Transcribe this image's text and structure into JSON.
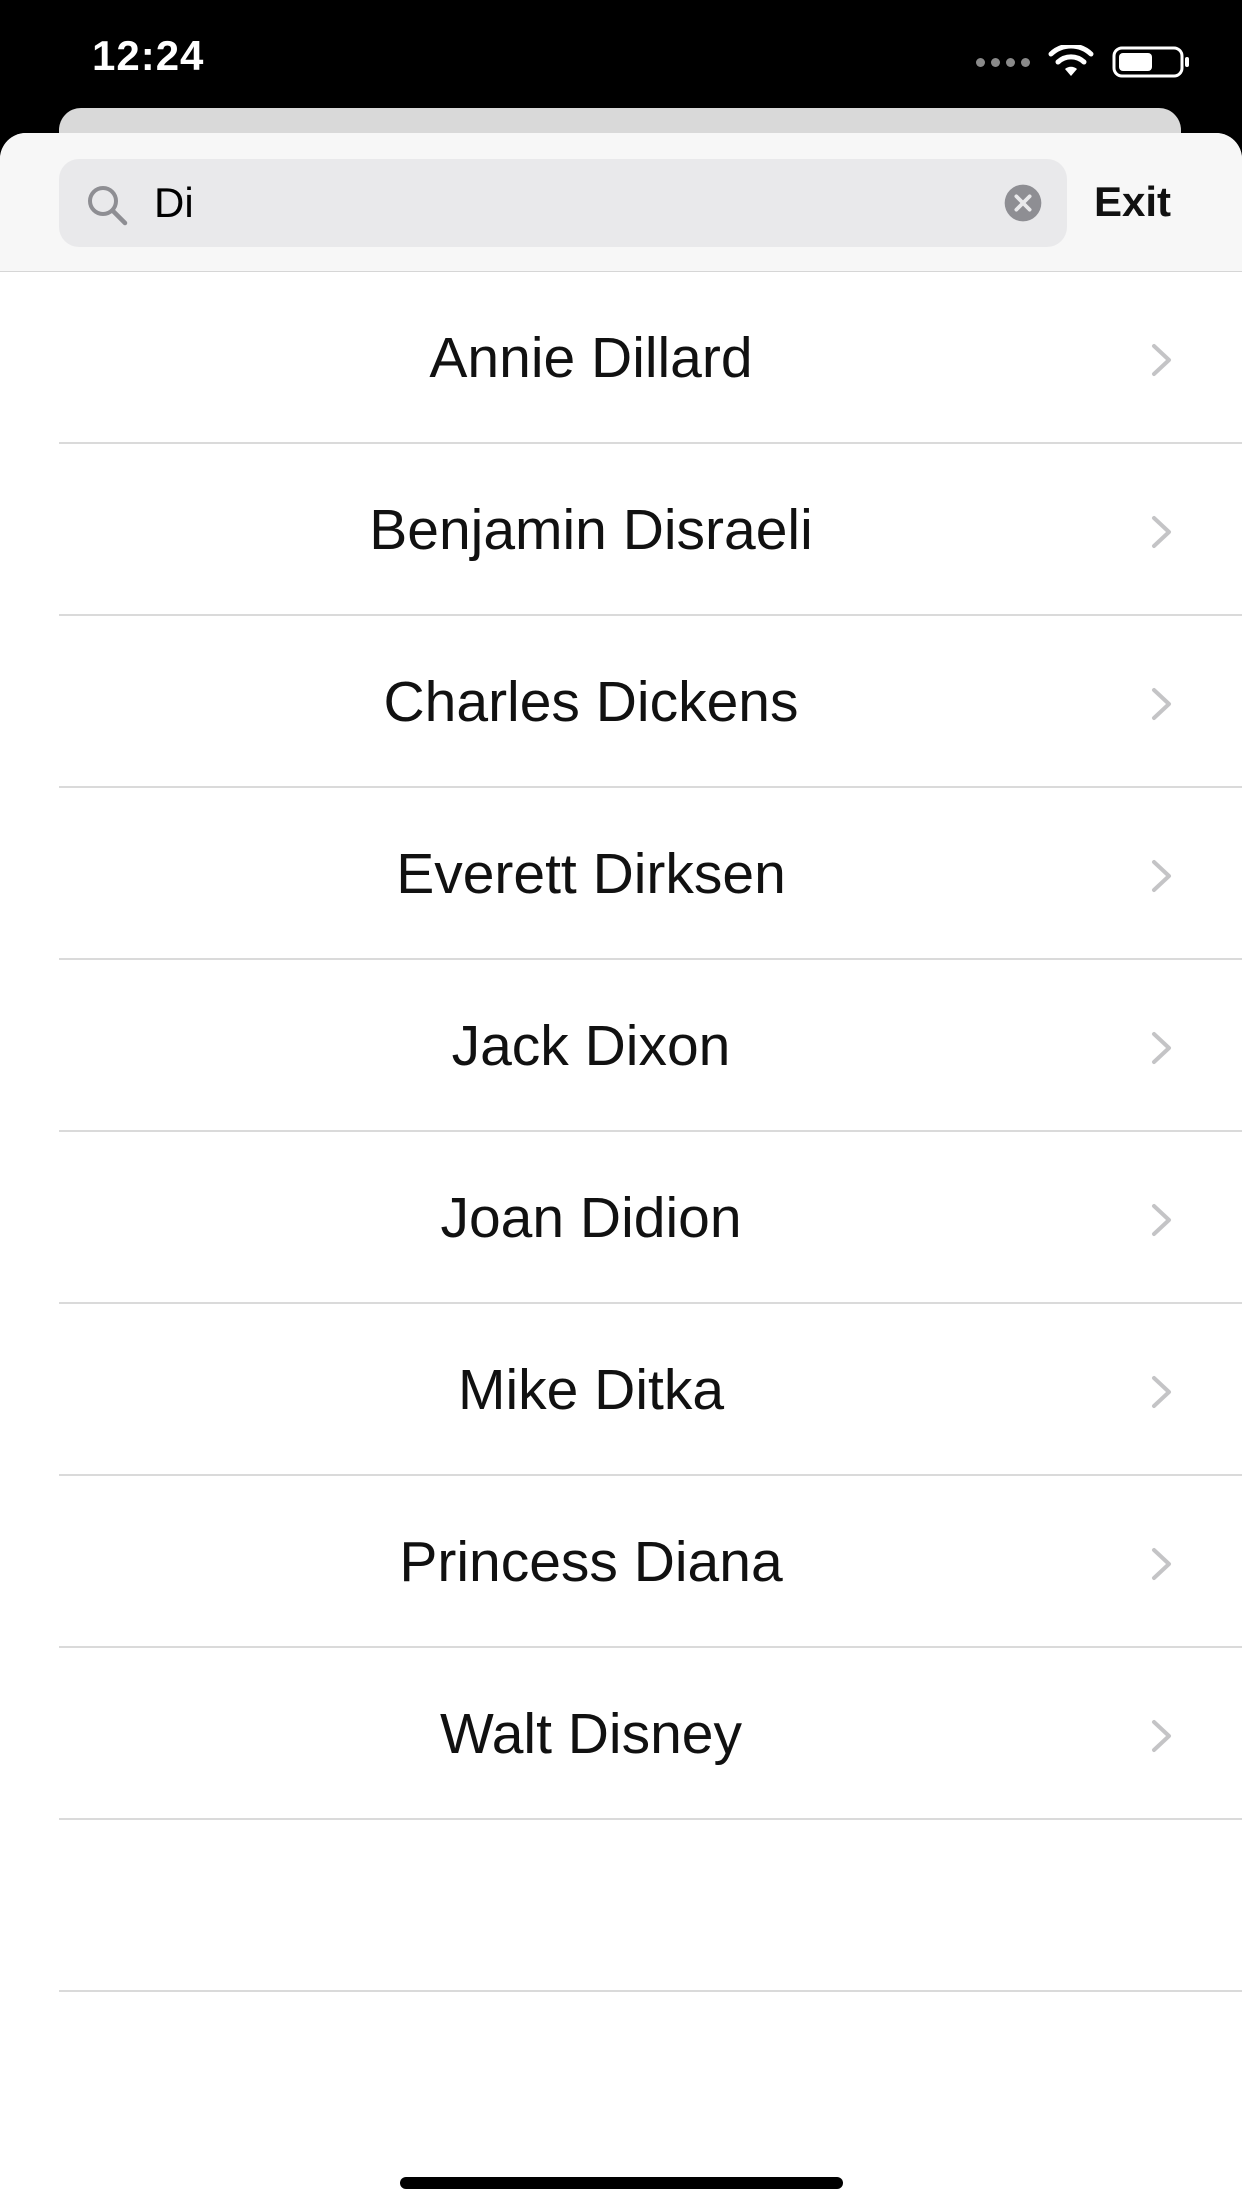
{
  "status_bar": {
    "time": "12:24"
  },
  "search": {
    "value": "Di",
    "exit_label": "Exit"
  },
  "results": [
    {
      "label": "Annie Dillard"
    },
    {
      "label": "Benjamin Disraeli"
    },
    {
      "label": "Charles Dickens"
    },
    {
      "label": "Everett Dirksen"
    },
    {
      "label": "Jack Dixon"
    },
    {
      "label": "Joan Didion"
    },
    {
      "label": "Mike Ditka"
    },
    {
      "label": "Princess Diana"
    },
    {
      "label": "Walt Disney"
    }
  ],
  "icons": {
    "search": "magnifying-glass",
    "clear": "x-circle",
    "disclosure": "chevron-right"
  },
  "colors": {
    "chevron": "#c4c4c6",
    "clear_icon": "#8e8e93",
    "separator": "#dadada"
  }
}
